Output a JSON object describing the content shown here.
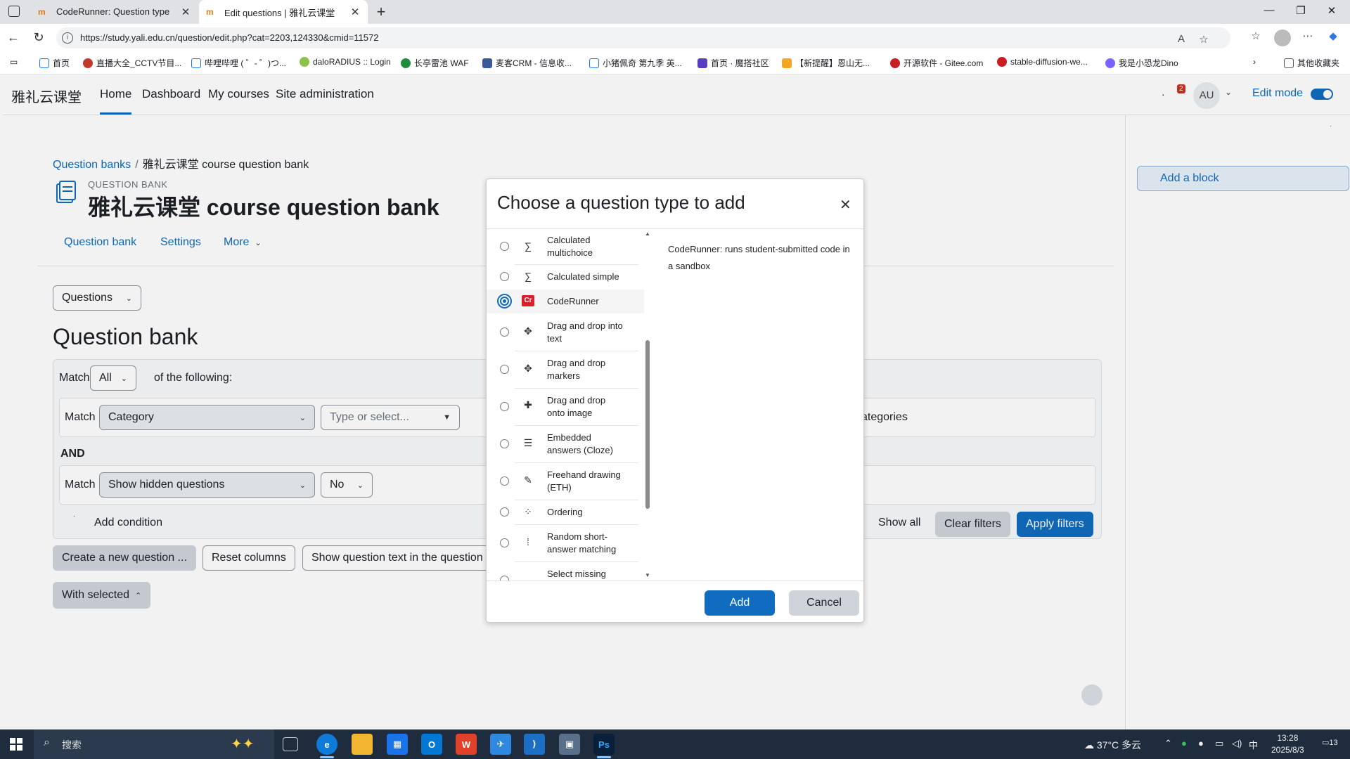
{
  "browser": {
    "tabs": [
      {
        "title": "CodeRunner: Question type"
      },
      {
        "title": "Edit questions | 雅礼云课堂"
      }
    ],
    "url": "https://study.yali.edu.cn/question/edit.php?cat=2203,124330&cmid=11572",
    "bookmarks": [
      {
        "label": "首页",
        "color": "#1a73e8"
      },
      {
        "label": "直播大全_CCTV节目...",
        "color": "#c0392b"
      },
      {
        "label": "哔哩哔哩 ( ゜- ゜)つ...",
        "color": "#1a73e8"
      },
      {
        "label": "daloRADIUS :: Login",
        "color": "#8bc34a"
      },
      {
        "label": "长亭雷池 WAF",
        "color": "#1e8e3e"
      },
      {
        "label": "麦客CRM - 信息收...",
        "color": "#3b5998"
      },
      {
        "label": "小猪佩奇 第九季 英...",
        "color": "#1a73e8"
      },
      {
        "label": "首页 · 魔搭社区",
        "color": "#5b3cc4"
      },
      {
        "label": "【新提醒】恩山无...",
        "color": "#f5a623"
      },
      {
        "label": "开源软件 - Gitee.com",
        "color": "#c71d23"
      },
      {
        "label": "stable-diffusion-we...",
        "color": "#c71d23"
      },
      {
        "label": "我是小恐龙Dino",
        "color": "#7b61ff"
      }
    ],
    "other_bookmarks": "其他收藏夹"
  },
  "site": {
    "name": "雅礼云课堂",
    "nav": [
      "Home",
      "Dashboard",
      "My courses",
      "Site administration"
    ],
    "notification_count": "2",
    "avatar_initials": "AU",
    "edit_mode_label": "Edit mode"
  },
  "drawer": {
    "add_block": "Add a block"
  },
  "page": {
    "breadcrumb": {
      "link": "Question banks",
      "sep": "/",
      "current": "雅礼云课堂 course question bank"
    },
    "subtitle": "QUESTION BANK",
    "title": "雅礼云课堂 course question bank",
    "tabs": [
      "Question bank",
      "Settings",
      "More"
    ],
    "questions_select": "Questions",
    "heading": "Question bank",
    "filters": {
      "match_label": "Match",
      "match_value": "All",
      "of_following": "of the following:",
      "row1_match": "Match",
      "row1_field": "Category",
      "row1_value_placeholder": "Type or select...",
      "row1_suffix": "ategories",
      "and_label": "AND",
      "row2_match": "Match",
      "row2_field": "Show hidden questions",
      "row2_value": "No",
      "add_condition": "Add condition",
      "show_all": "Show all",
      "clear": "Clear filters",
      "apply": "Apply filters"
    },
    "buttons": {
      "create": "Create a new question ...",
      "reset_columns": "Reset columns",
      "show_text": "Show question text in the question",
      "with_selected": "With selected"
    }
  },
  "modal": {
    "title": "Choose a question type to add",
    "types": [
      {
        "label": "Calculated multichoice",
        "icon": "calculated-multichoice-icon"
      },
      {
        "label": "Calculated simple",
        "icon": "calculated-simple-icon"
      },
      {
        "label": "CodeRunner",
        "icon": "coderunner-icon",
        "selected": true
      },
      {
        "label": "Drag and drop into text",
        "icon": "drag-drop-text-icon"
      },
      {
        "label": "Drag and drop markers",
        "icon": "drag-drop-markers-icon"
      },
      {
        "label": "Drag and drop onto image",
        "icon": "drag-drop-image-icon"
      },
      {
        "label": "Embedded answers (Cloze)",
        "icon": "cloze-icon"
      },
      {
        "label": "Freehand drawing (ETH)",
        "icon": "freehand-icon"
      },
      {
        "label": "Ordering",
        "icon": "ordering-icon"
      },
      {
        "label": "Random short-answer matching",
        "icon": "random-match-icon"
      },
      {
        "label": "Select missing",
        "icon": "select-missing-icon"
      }
    ],
    "description": "CodeRunner: runs student-submitted code in a sandbox",
    "add": "Add",
    "cancel": "Cancel"
  },
  "taskbar": {
    "search": "搜索",
    "weather_temp": "37°C",
    "weather_desc": "多云",
    "ime": "中",
    "time": "13:28",
    "date": "2025/8/3",
    "notification_count": "13"
  }
}
